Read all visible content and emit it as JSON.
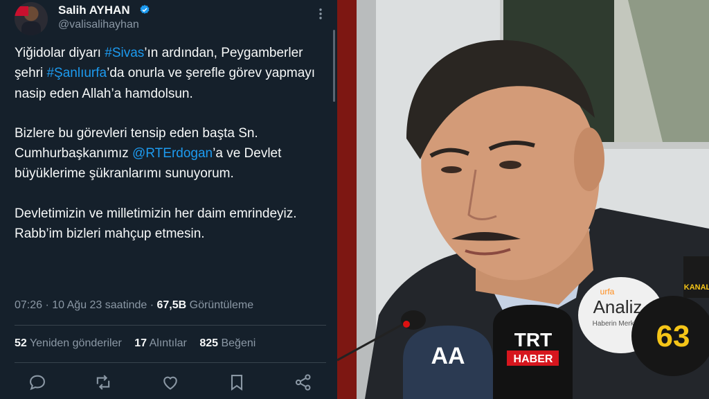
{
  "tweet": {
    "author_name": "Salih AYHAN",
    "author_handle": "@valisalihayhan",
    "body": {
      "p1_a": "Yiğidolar diyarı ",
      "p1_tag1": "#Sivas",
      "p1_b": "’ın ardından, Peygamberler şehri ",
      "p1_tag2": "#Şanlıurfa",
      "p1_c": "’da onurla ve şerefle görev yapmayı nasip eden Allah’a hamdolsun.",
      "p2_a": "Bizlere bu görevleri tensip eden başta Sn. Cumhurbaşkanımız ",
      "p2_mention": "@RTErdogan",
      "p2_b": "’a ve Devlet büyüklerime şükranlarımı sunuyorum.",
      "p3": "Devletimizin ve milletimizin her daim emrindeyiz. Rabb’im bizleri mahçup etmesin."
    },
    "meta": {
      "time_date": "07:26 · 10 Ağu 23 saatinde · ",
      "views_count": "67,5B",
      "views_label": " Görüntüleme"
    },
    "stats": [
      {
        "count": "52",
        "label": "Yeniden gönderiler"
      },
      {
        "count": "17",
        "label": "Alıntılar"
      },
      {
        "count": "825",
        "label": "Beğeni"
      }
    ]
  },
  "photo": {
    "mic_logos": {
      "aa": "AA",
      "trt": "TRT",
      "haber": "HABER",
      "analiz_brand": "urfa",
      "analiz": "Analiz",
      "analiz_sub": "Haberin Merkezi",
      "channel_num": "63",
      "kanal": "KANAL"
    }
  },
  "colors": {
    "background": "#15202b",
    "accent": "#1d9bf0",
    "text": "#f7f9f9",
    "muted": "#8b98a5"
  },
  "icons": [
    "verified-badge-icon",
    "more-options-icon",
    "reply-icon",
    "retweet-icon",
    "like-icon",
    "bookmark-icon",
    "share-icon"
  ]
}
